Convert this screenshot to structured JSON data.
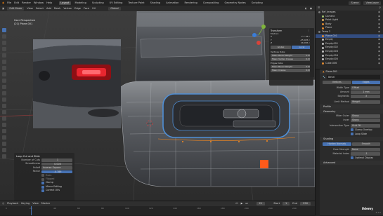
{
  "menubar": {
    "items": [
      "File",
      "Edit",
      "Render",
      "Window",
      "Help"
    ],
    "workspaces": [
      "Layout",
      "Modeling",
      "Sculpting",
      "UV Editing",
      "Texture Paint",
      "Shading",
      "Animation",
      "Rendering",
      "Compositing",
      "Geometry Nodes",
      "Scripting"
    ],
    "active_workspace": "Layout",
    "scene_label": "Scene",
    "view_layer_label": "ViewLayer"
  },
  "viewport_header": {
    "mode": "Edit Mode",
    "menus": [
      "View",
      "Select",
      "Add",
      "Mesh",
      "Vertex",
      "Edge",
      "Face",
      "UV"
    ],
    "transform": "Global"
  },
  "viewport": {
    "view_name": "User Perspective",
    "object_name": "(21) Plane.001"
  },
  "n_panel": {
    "title": "Transform",
    "header": "Median:",
    "rows": [
      {
        "k": "X",
        "v": "-7.7 48 cm"
      },
      {
        "k": "Y",
        "v": "-25.045 cm"
      },
      {
        "k": "Z",
        "v": "26.095 cm"
      }
    ],
    "toggle": [
      "Global",
      "Local"
    ],
    "sections": [
      {
        "label": "Vertices Data:",
        "btn": "Mean Bevel Weight",
        "val": "0.00"
      },
      {
        "label": "",
        "btn": "Mean Vertex Crease",
        "val": "0.00"
      },
      {
        "label": "Edges Data:",
        "btn": "Mean Bevel Weight",
        "val": "0.00"
      },
      {
        "label": "",
        "btn": "Mean Crease",
        "val": "0.00"
      }
    ]
  },
  "operator_panel": {
    "title": "Loop Cut and Slide",
    "fields": [
      {
        "k": "Number of Cuts",
        "v": "1"
      },
      {
        "k": "Smoothness",
        "v": "0.000"
      },
      {
        "k": "Falloff",
        "v": "Inverse Square"
      },
      {
        "k": "Factor",
        "v": "-0.789"
      }
    ],
    "checks": [
      {
        "label": "Even",
        "on": false
      },
      {
        "label": "Flipped",
        "on": false
      },
      {
        "label": "Clamp",
        "on": true
      },
      {
        "label": "Mirror Editing",
        "on": true
      },
      {
        "label": "Correct UVs",
        "on": true
      }
    ]
  },
  "timeline": {
    "menus": [
      "Playback",
      "Keying",
      "View",
      "Marker"
    ],
    "frame": "21",
    "start_label": "Start",
    "start": "1",
    "end_label": "End",
    "end": "250",
    "ticks": [
      "0",
      "20",
      "40",
      "60",
      "80",
      "100",
      "120",
      "140",
      "160",
      "180",
      "200",
      "220",
      "240"
    ]
  },
  "outliner": {
    "items": [
      {
        "label": "Ref_Images",
        "color": "#7a7a7a"
      },
      {
        "label": "Camera",
        "color": "#a0c070"
      },
      {
        "label": "Point Light",
        "color": "#e0b060"
      },
      {
        "label": "Body",
        "color": "#e08a30"
      },
      {
        "label": "Plane",
        "color": "#e08a30"
      },
      {
        "label": "Temp 2",
        "color": "#7a7a7a"
      },
      {
        "label": "Plane.001",
        "color": "#e08a30"
      },
      {
        "label": "Empty",
        "color": "#bfbfbf"
      },
      {
        "label": "Empty.001",
        "color": "#bfbfbf"
      },
      {
        "label": "Empty.002",
        "color": "#bfbfbf"
      },
      {
        "label": "Empty.003",
        "color": "#bfbfbf"
      },
      {
        "label": "Empty.004",
        "color": "#bfbfbf"
      },
      {
        "label": "Empty.005",
        "color": "#bfbfbf"
      },
      {
        "label": "Cube.006",
        "color": "#e08a30"
      }
    ]
  },
  "properties": {
    "object": "Plane.001",
    "modifier": "Bevel",
    "tabs": [
      "Vertices",
      "Edges"
    ],
    "active_tab": "Edges",
    "rows": [
      {
        "k": "Width Type",
        "v": "Offset"
      },
      {
        "k": "Amount",
        "v": "1 mm"
      },
      {
        "k": "Segments",
        "v": "3"
      }
    ],
    "limit_method": {
      "k": "Limit Method",
      "v": "Weight"
    },
    "profile_section": "Profile",
    "geometry_section": "Geometry",
    "geom_rows": [
      {
        "k": "Miter Outer",
        "v": "Sharp"
      },
      {
        "k": "Inner",
        "v": "Sharp"
      }
    ],
    "intersection": {
      "k": "Intersection Type",
      "v": "Grid Fill"
    },
    "checks": [
      "Clamp Overlap",
      "Loop Slide"
    ],
    "shading_section": "Shading",
    "harden": [
      "Harden Normals",
      "Smooth"
    ],
    "face_strength": {
      "k": "Face Strength",
      "v": "None"
    },
    "material_row": {
      "k": "Material Index",
      "v": "-1"
    },
    "optimal": "Optimal Display",
    "advanced": "Advanced",
    "version": "3.1.0"
  },
  "watermark": "Udemy"
}
